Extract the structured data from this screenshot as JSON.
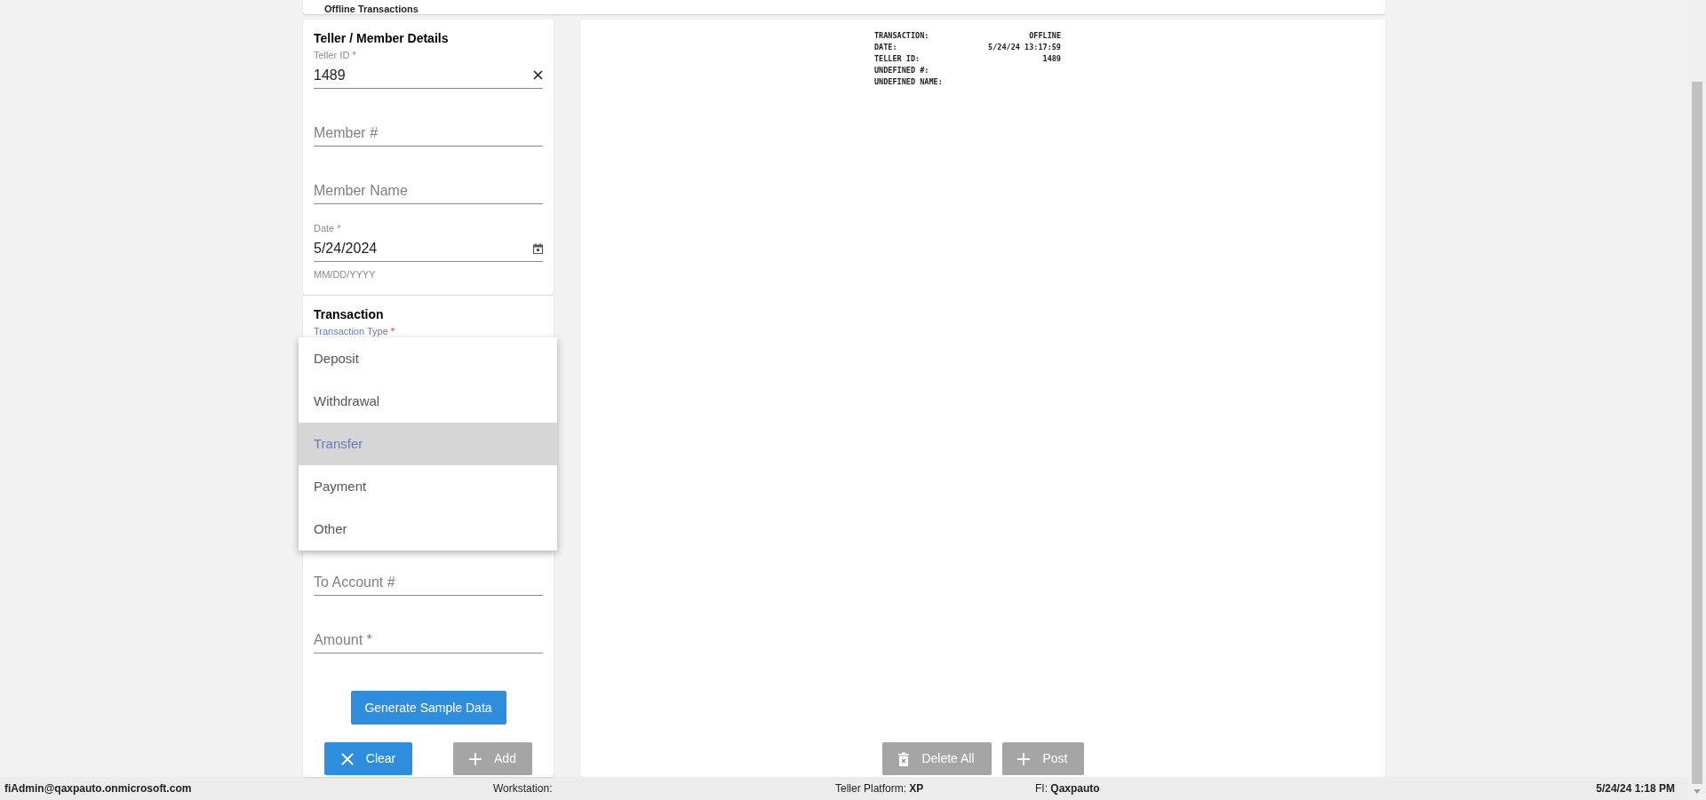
{
  "header": {
    "title": "Offline Transactions"
  },
  "member_details": {
    "title": "Teller / Member Details",
    "fields": [
      {
        "kind": "text",
        "label": "Teller ID *",
        "value": "1489",
        "clearable": true
      },
      {
        "kind": "text",
        "placeholder": "Member #"
      },
      {
        "kind": "text",
        "placeholder": "Member Name"
      },
      {
        "kind": "date",
        "label": "Date *",
        "value": "5/24/2024",
        "hint": "MM/DD/YYYY"
      }
    ]
  },
  "transaction": {
    "title": "Transaction",
    "type_label": "Transaction Type",
    "required_mark": "*",
    "menu": {
      "items": [
        {
          "label": "Deposit",
          "selected": false
        },
        {
          "label": "Withdrawal",
          "selected": false
        },
        {
          "label": "Transfer",
          "selected": true
        },
        {
          "label": "Payment",
          "selected": false
        },
        {
          "label": "Other",
          "selected": false
        }
      ]
    },
    "fields": [
      {
        "kind": "text",
        "placeholder": "To Account #"
      },
      {
        "kind": "text",
        "placeholder": "Amount *"
      }
    ],
    "buttons": [
      {
        "kind": "generate",
        "label": "Generate Sample Data",
        "disabled": false
      },
      {
        "kind": "clear",
        "label": "Clear",
        "disabled": false
      },
      {
        "kind": "add",
        "label": "Add",
        "disabled": true
      }
    ]
  },
  "receipt": {
    "lines": [
      {
        "label": "TRANSACTION:",
        "value": "OFFLINE"
      },
      {
        "label": "DATE:",
        "value": "5/24/24 13:17:59"
      },
      {
        "label": "TELLER ID:",
        "value": "1489"
      },
      {
        "label": "UNDEFINED #:"
      },
      {
        "label": "UNDEFINED NAME:"
      }
    ],
    "buttons": [
      {
        "kind": "delete",
        "label": "Delete All",
        "disabled": true
      },
      {
        "kind": "add",
        "label": "Post",
        "disabled": true
      }
    ]
  },
  "status_bar": {
    "user": "fiAdmin@qaxpauto.onmicrosoft.com",
    "workstation_label": "Workstation:",
    "platform_label": "Teller Platform:",
    "platform": "XP",
    "fi_label": "FI:",
    "fi": "Qaxpauto",
    "datetime": "5/24/24 1:18 PM"
  }
}
